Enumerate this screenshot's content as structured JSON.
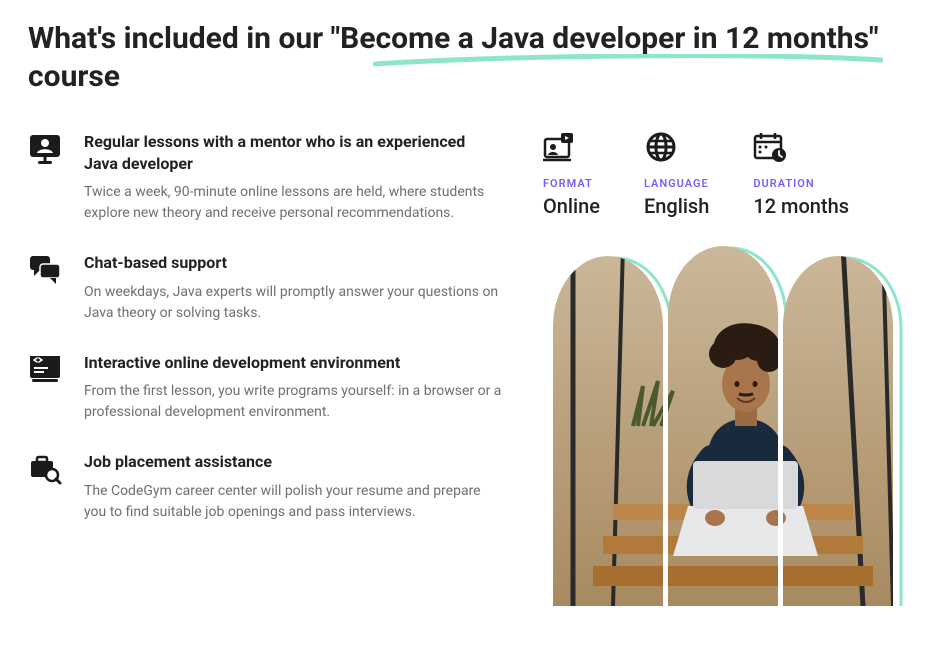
{
  "heading": "What's included in our \"Become a Java developer in 12 months\" course",
  "features": [
    {
      "title": "Regular lessons with a mentor who is an experienced Java developer",
      "desc": "Twice a week, 90-minute online lessons are held, where students explore new theory and receive personal recommendations."
    },
    {
      "title": "Chat-based support",
      "desc": "On weekdays, Java experts will promptly answer your questions on Java theory or solving tasks."
    },
    {
      "title": "Interactive online development environment",
      "desc": "From the first lesson, you write programs yourself: in a browser or a professional development environment."
    },
    {
      "title": "Job placement assistance",
      "desc": "The CodeGym career center will polish your resume and prepare you to find suitable job openings and pass interviews."
    }
  ],
  "meta": {
    "format": {
      "label": "FORMAT",
      "value": "Online"
    },
    "language": {
      "label": "LANGUAGE",
      "value": "English"
    },
    "duration": {
      "label": "DURATION",
      "value": "12 months"
    }
  }
}
